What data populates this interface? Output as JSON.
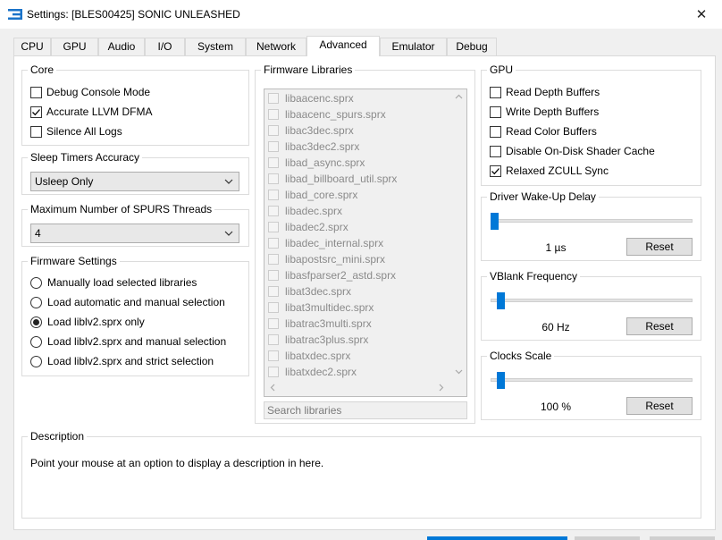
{
  "window": {
    "title": "Settings: [BLES00425] SONIC UNLEASHED",
    "close_glyph": "✕"
  },
  "tabs": [
    {
      "label": "CPU",
      "active": false
    },
    {
      "label": "GPU",
      "active": false
    },
    {
      "label": "Audio",
      "active": false
    },
    {
      "label": "I/O",
      "active": false
    },
    {
      "label": "System",
      "active": false
    },
    {
      "label": "Network",
      "active": false
    },
    {
      "label": "Advanced",
      "active": true
    },
    {
      "label": "Emulator",
      "active": false
    },
    {
      "label": "Debug",
      "active": false
    }
  ],
  "core": {
    "title": "Core",
    "options": [
      {
        "label": "Debug Console Mode",
        "checked": false
      },
      {
        "label": "Accurate LLVM DFMA",
        "checked": true
      },
      {
        "label": "Silence All Logs",
        "checked": false
      }
    ]
  },
  "sleep_timers": {
    "title": "Sleep Timers Accuracy",
    "selected": "Usleep Only"
  },
  "spurs_threads": {
    "title": "Maximum Number of SPURS Threads",
    "selected": "4"
  },
  "firmware_settings": {
    "title": "Firmware Settings",
    "options": [
      {
        "label": "Manually load selected libraries",
        "selected": false
      },
      {
        "label": "Load automatic and manual selection",
        "selected": false
      },
      {
        "label": "Load liblv2.sprx only",
        "selected": true
      },
      {
        "label": "Load liblv2.sprx and manual selection",
        "selected": false
      },
      {
        "label": "Load liblv2.sprx and strict selection",
        "selected": false
      }
    ]
  },
  "firmware_libraries": {
    "title": "Firmware Libraries",
    "items": [
      "libaacenc.sprx",
      "libaacenc_spurs.sprx",
      "libac3dec.sprx",
      "libac3dec2.sprx",
      "libad_async.sprx",
      "libad_billboard_util.sprx",
      "libad_core.sprx",
      "libadec.sprx",
      "libadec2.sprx",
      "libadec_internal.sprx",
      "libapostsrc_mini.sprx",
      "libasfparser2_astd.sprx",
      "libat3dec.sprx",
      "libat3multidec.sprx",
      "libatrac3multi.sprx",
      "libatrac3plus.sprx",
      "libatxdec.sprx",
      "libatxdec2.sprx"
    ],
    "search_placeholder": "Search libraries"
  },
  "gpu": {
    "title": "GPU",
    "options": [
      {
        "label": "Read Depth Buffers",
        "checked": false
      },
      {
        "label": "Write Depth Buffers",
        "checked": false
      },
      {
        "label": "Read Color Buffers",
        "checked": false
      },
      {
        "label": "Disable On-Disk Shader Cache",
        "checked": false
      },
      {
        "label": "Relaxed ZCULL Sync",
        "checked": true
      }
    ]
  },
  "driver_wakeup": {
    "title": "Driver Wake-Up Delay",
    "value_text": "1 µs",
    "level": 0.0,
    "reset_label": "Reset"
  },
  "vblank": {
    "title": "VBlank Frequency",
    "value_text": "60 Hz",
    "level": 0.03,
    "reset_label": "Reset"
  },
  "clocks_scale": {
    "title": "Clocks Scale",
    "value_text": "100 %",
    "level": 0.03,
    "reset_label": "Reset"
  },
  "description": {
    "title": "Description",
    "text": "Point your mouse at an option to display a description in here."
  },
  "colors": {
    "accent": "#0078d7",
    "checkmark": "#000000"
  }
}
